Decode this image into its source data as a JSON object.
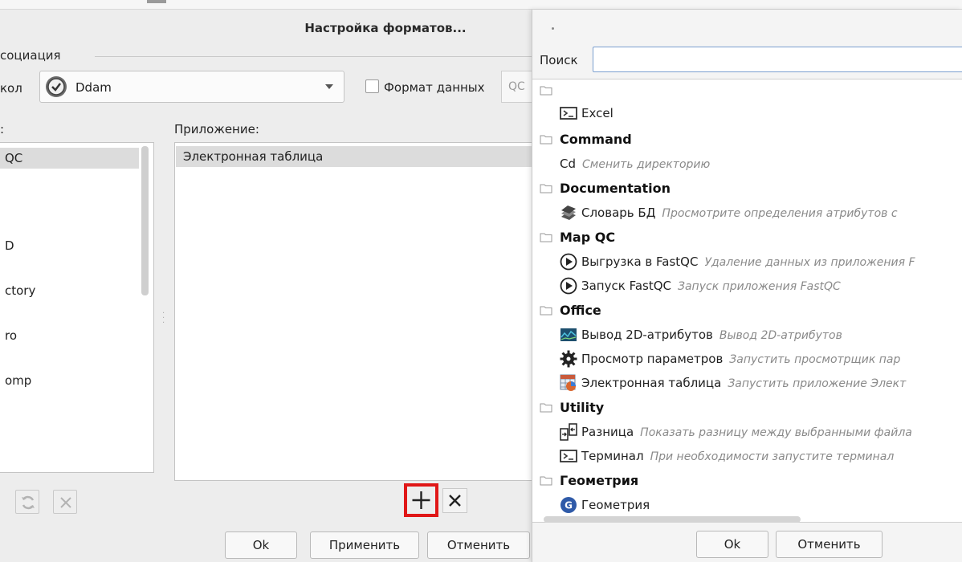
{
  "dialog": {
    "title": "Настройка форматов...",
    "group_label": "социация",
    "protocol_label": "кол",
    "protocol_value": "Ddam",
    "data_format_label": "Формат данных",
    "data_format_value": "QC",
    "left_column_label": ":",
    "right_column_label": "Приложение:",
    "left_items": [
      "QC",
      "D",
      "ctory",
      "ro",
      "omp"
    ],
    "right_items": [
      "Электронная таблица"
    ],
    "buttons": {
      "ok": "Ok",
      "apply": "Применить",
      "cancel": "Отменить"
    }
  },
  "popup": {
    "search_label": "Поиск",
    "search_value": "",
    "ungrouped": [
      {
        "name": "Excel",
        "description": "",
        "icon": "terminal-icon"
      }
    ],
    "categories": [
      {
        "name": "Command",
        "apps": [
          {
            "name": "Cd",
            "description": "Сменить директорию",
            "icon": ""
          }
        ]
      },
      {
        "name": "Documentation",
        "apps": [
          {
            "name": "Словарь БД",
            "description": "Просмотрите определения атрибутов с",
            "icon": "books-icon"
          }
        ]
      },
      {
        "name": "Map QC",
        "apps": [
          {
            "name": "Выгрузка в FastQC",
            "description": "Удаление данных из приложения F",
            "icon": "play-icon"
          },
          {
            "name": "Запуск FastQC",
            "description": "Запуск приложения FastQC",
            "icon": "play-icon"
          }
        ]
      },
      {
        "name": "Office",
        "apps": [
          {
            "name": "Вывод 2D-атрибутов",
            "description": "Вывод 2D-атрибутов",
            "icon": "chart-icon"
          },
          {
            "name": "Просмотр параметров",
            "description": "Запустить просмотрщик пар",
            "icon": "gear-icon"
          },
          {
            "name": "Электронная таблица",
            "description": "Запустить приложение Элект",
            "icon": "spreadsheet-icon"
          }
        ]
      },
      {
        "name": "Utility",
        "apps": [
          {
            "name": "Разница",
            "description": "Показать разницу между выбранными файла",
            "icon": "diff-icon"
          },
          {
            "name": "Терминал",
            "description": "При необходимости запустите терминал",
            "icon": "terminal-icon"
          }
        ]
      },
      {
        "name": "Геометрия",
        "apps": [
          {
            "name": "Геометрия",
            "description": "",
            "icon": "geometry-icon"
          }
        ]
      }
    ],
    "buttons": {
      "ok": "Ok",
      "cancel": "Отменить"
    }
  },
  "colors": {
    "highlight_red": "#e01717",
    "selection_gray": "#dcdcdc"
  }
}
